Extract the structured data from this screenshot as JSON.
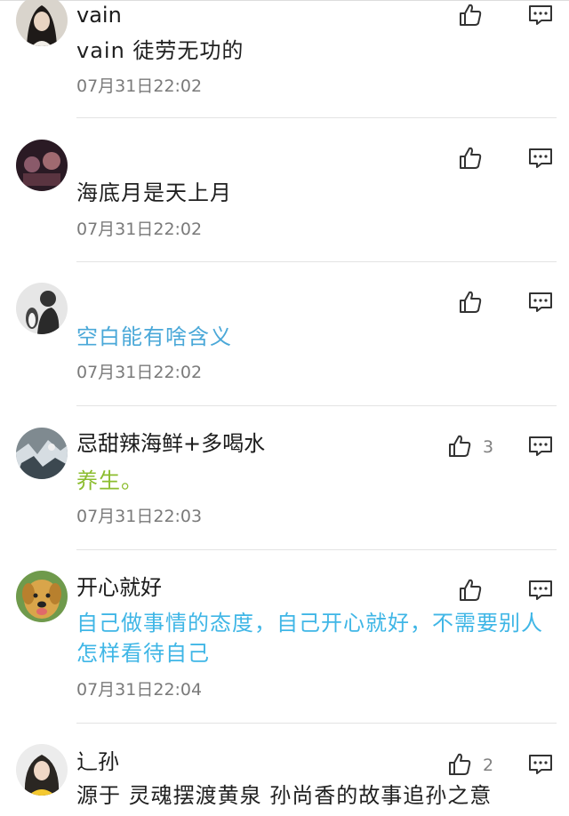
{
  "comments": [
    {
      "name": "vain",
      "text": "vain  徒劳无功的",
      "time": "07月31日22:02",
      "likes": "",
      "text_color": "#1f1f1f"
    },
    {
      "name": "",
      "text": "海底月是天上月",
      "time": "07月31日22:02",
      "likes": "",
      "text_color": "#1f1f1f"
    },
    {
      "name": "",
      "text": "空白能有啥含义",
      "time": "07月31日22:02",
      "likes": "",
      "text_color": "#4aa8d8"
    },
    {
      "name": "忌甜辣海鲜+多喝水",
      "text": "养生。",
      "time": "07月31日22:03",
      "likes": "3",
      "text_color": "#8cbd2f"
    },
    {
      "name": "开心就好",
      "text": "自己做事情的态度，自己开心就好，不需要别人怎样看待自己",
      "time": "07月31日22:04",
      "likes": "",
      "text_color": "#3fb6e6"
    },
    {
      "name": "辶孙",
      "text": "源于  灵魂摆渡黄泉  孙尚香的故事追孙之意",
      "time": "",
      "likes": "2",
      "text_color": "#1f1f1f"
    }
  ],
  "icons": {
    "like": "thumbs-up-icon",
    "reply": "comment-bubble-icon"
  }
}
